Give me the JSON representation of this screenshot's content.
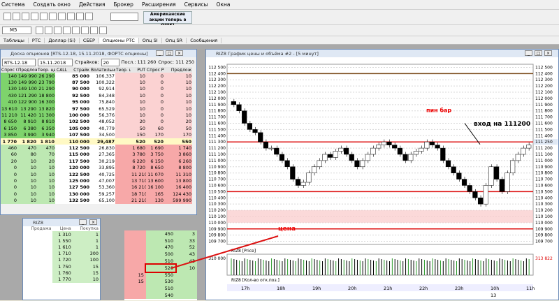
{
  "menu": [
    "Система",
    "Создать окно",
    "Действия",
    "Брокер",
    "Расширения",
    "Сервисы",
    "Окна"
  ],
  "toolbar": {
    "timeframe": "M5",
    "ad_text": "Американские акции теперь в QUIK!"
  },
  "tabs": [
    "Таблицы",
    "РТС",
    "Доллар (Si)",
    "СБЕР",
    "Опционы РТС",
    "Опц SI",
    "Опц SR",
    "Сообщения"
  ],
  "board": {
    "title": "Доска опционов [RTS-12.18, 15.11.2018, ФОРТС опционы]",
    "instrument": "RTS-12.18",
    "date": "15.11.2018",
    "strikes_label": "Страйков:",
    "strikes": "20",
    "last": "Посл.: 111 260",
    "offer": "Спрос: 111 250",
    "headers": [
      "Спрос CA",
      "Предлож",
      "Теор. цен",
      "CALL",
      "Страйк",
      "Волатильность",
      "Теор. цен",
      "PUT",
      "Спрос PUT",
      "Предлож"
    ],
    "rows": [
      [
        "140",
        "149 990",
        "26 290",
        "",
        "85 000",
        "106,337",
        "",
        "10",
        "0",
        "10"
      ],
      [
        "130",
        "149 990",
        "23 790",
        "",
        "87 500",
        "100,322",
        "",
        "10",
        "0",
        "10"
      ],
      [
        "130",
        "149 100",
        "21 290",
        "",
        "90 000",
        "92,914",
        "",
        "10",
        "0",
        "10"
      ],
      [
        "430",
        "121 290",
        "18 800",
        "",
        "92 500",
        "84,348",
        "",
        "10",
        "0",
        "10"
      ],
      [
        "410",
        "122 900",
        "16 300",
        "",
        "95 000",
        "75,840",
        "",
        "10",
        "0",
        "10"
      ],
      [
        "13 610",
        "13 290",
        "13 820",
        "",
        "97 500",
        "65,529",
        "",
        "10",
        "0",
        "10"
      ],
      [
        "11 210",
        "11 420",
        "11 300",
        "",
        "100 000",
        "56,376",
        "",
        "10",
        "0",
        "10"
      ],
      [
        "8 650",
        "8 910",
        "8 810",
        "",
        "102 500",
        "48,052",
        "",
        "20",
        "0",
        "20"
      ],
      [
        "6 150",
        "6 380",
        "6 350",
        "",
        "105 000",
        "40,779",
        "",
        "50",
        "60",
        "50"
      ],
      [
        "3 850",
        "3 990",
        "3 940",
        "",
        "107 500",
        "34,500",
        "",
        "150",
        "170",
        "170"
      ],
      [
        "1 770",
        "1 820",
        "1 810",
        "",
        "110 000",
        "29,487",
        "",
        "520",
        "520",
        "550"
      ],
      [
        "460",
        "470",
        "470",
        "",
        "112 500",
        "26,830",
        "",
        "1 680",
        "1 690",
        "1 740"
      ],
      [
        "60",
        "80",
        "70",
        "",
        "115 000",
        "27,365",
        "",
        "3 780",
        "3 750",
        "3 860"
      ],
      [
        "20",
        "10",
        "20",
        "",
        "117 500",
        "30,219",
        "",
        "6 220",
        "6 150",
        "6 260"
      ],
      [
        "0",
        "10",
        "10",
        "",
        "120 000",
        "33,895",
        "",
        "8 720",
        "8 650",
        "8 800"
      ],
      [
        "0",
        "10",
        "10",
        "",
        "122 500",
        "40,725",
        "",
        "11 210",
        "11 070",
        "11 310"
      ],
      [
        "0",
        "10",
        "10",
        "",
        "125 000",
        "47,007",
        "",
        "13 710",
        "13 600",
        "13 800"
      ],
      [
        "0",
        "10",
        "10",
        "",
        "127 500",
        "53,360",
        "",
        "16 210",
        "16 100",
        "16 400"
      ],
      [
        "0",
        "10",
        "10",
        "",
        "130 000",
        "59,257",
        "",
        "18 710",
        "165",
        "124 430"
      ],
      [
        "0",
        "10",
        "10",
        "",
        "132 500",
        "65,100",
        "",
        "21 210",
        "130",
        "599 990"
      ]
    ]
  },
  "riz": {
    "title": "RIZ8",
    "headers": [
      "Продажа",
      "Цена",
      "Покупка"
    ],
    "rows": [
      [
        "",
        "1 310",
        "1"
      ],
      [
        "",
        "1 550",
        "1"
      ],
      [
        "",
        "1 610",
        "1"
      ],
      [
        "",
        "1 710",
        "300"
      ],
      [
        "",
        "1 720",
        "100"
      ],
      [
        "",
        "1 750",
        "15"
      ],
      [
        "",
        "1 760",
        "15"
      ],
      [
        "",
        "1 770",
        "10"
      ]
    ]
  },
  "vol": {
    "rows": [
      [
        "",
        "450",
        "3"
      ],
      [
        "",
        "510",
        "33"
      ],
      [
        "",
        "470",
        "52"
      ],
      [
        "",
        "500",
        "43"
      ],
      [
        "",
        "510",
        "43"
      ],
      [
        "",
        "520",
        "10"
      ],
      [
        "15",
        "550",
        ""
      ],
      [
        "15",
        "530",
        ""
      ],
      [
        "",
        "510",
        ""
      ],
      [
        "",
        "540",
        ""
      ]
    ]
  },
  "chart": {
    "title": "RIZ8 График цены и объёма #2 - [5 минут]",
    "price_series": "RIZ8 [Price]",
    "volume_series": "RIZ8 [Кол-во отк.поз.]",
    "volume_tick": "310 000",
    "y_ticks": [
      "112 500",
      "112 400",
      "112 300",
      "112 200",
      "112 100",
      "112 000",
      "111 900",
      "111 800",
      "111 700",
      "111 600",
      "111 500",
      "111 400",
      "111 300",
      "111 200",
      "111 100",
      "111 000",
      "110 900",
      "110 800",
      "110 700",
      "110 600",
      "110 500",
      "110 400",
      "110 300",
      "110 200",
      "110 100",
      "110 000",
      "109 900",
      "109 800",
      "109 700"
    ],
    "x_ticks": [
      "17h",
      "18h",
      "19h",
      "20h",
      "21h",
      "22h",
      "23h",
      "10h",
      "11h"
    ],
    "date_label": "13",
    "labels": {
      "pin": "пин бар",
      "entry": "вход на 111200",
      "price": "цена"
    },
    "current_price": "111 250",
    "current_volume": "313 822",
    "levels": [
      111300,
      110500,
      109900
    ],
    "zone": [
      110000,
      110200
    ],
    "path": [
      111900,
      111800,
      111600,
      111500,
      111450,
      111300,
      111200,
      111200,
      111100,
      111000,
      110900,
      110700,
      110600,
      110650,
      110800,
      110900,
      111000,
      111100,
      111050,
      111150,
      111200,
      111100,
      111000,
      110900,
      111000,
      111100,
      111200,
      111250,
      111300,
      111250,
      111200,
      111100,
      111000,
      111100,
      111150,
      111200,
      111300,
      111250,
      111200,
      111000,
      110900,
      110800,
      110700,
      110600,
      110500,
      110400,
      110300,
      110600,
      110900,
      110700,
      110500,
      110800,
      111000,
      111100,
      111200,
      111250
    ]
  }
}
